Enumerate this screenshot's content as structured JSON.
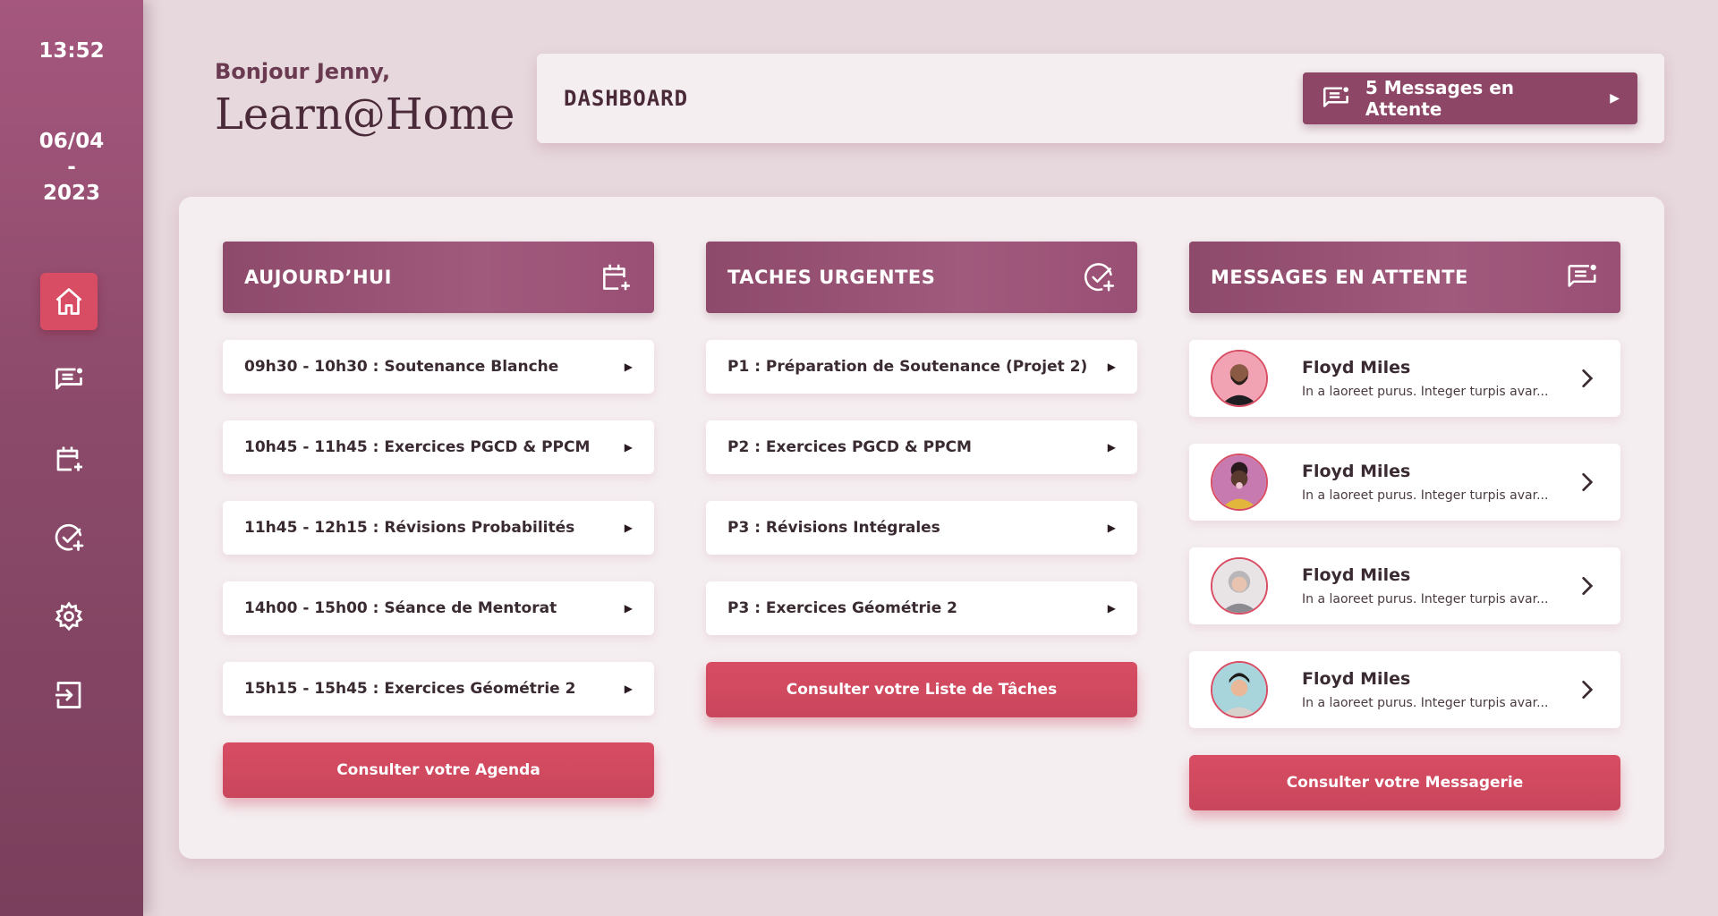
{
  "sidebar": {
    "time": "13:52",
    "date_line1": "06/04",
    "date_line2": "-",
    "date_line3": "2023",
    "nav": [
      "home-icon",
      "messages-icon",
      "calendar-add-icon",
      "task-check-icon",
      "settings-icon",
      "logout-icon"
    ],
    "active_index": 0
  },
  "header": {
    "greeting": "Bonjour Jenny,",
    "brand": "Learn@Home",
    "title": "DASHBOARD",
    "messages_button": "5 Messages en Attente"
  },
  "columns": {
    "today": {
      "title": "AUJOURD’HUI",
      "items": [
        "09h30 - 10h30 : Soutenance Blanche",
        "10h45 - 11h45 : Exercices PGCD & PPCM",
        "11h45 - 12h15 : Révisions Probabilités",
        "14h00 - 15h00 : Séance de Mentorat",
        "15h15 - 15h45 : Exercices Géométrie 2"
      ],
      "cta": "Consulter votre Agenda"
    },
    "urgent": {
      "title": "TACHES URGENTES",
      "items": [
        "P1 : Préparation de Soutenance (Projet 2)",
        "P2 : Exercices PGCD & PPCM",
        "P3 : Révisions Intégrales",
        "P3 : Exercices Géométrie 2"
      ],
      "cta": "Consulter votre Liste de Tâches"
    },
    "messages": {
      "title": "MESSAGES EN ATTENTE",
      "items": [
        {
          "name": "Floyd Miles",
          "preview": "In a laoreet purus. Integer turpis avar..."
        },
        {
          "name": "Floyd Miles",
          "preview": "In a laoreet purus. Integer turpis avar..."
        },
        {
          "name": "Floyd Miles",
          "preview": "In a laoreet purus. Integer turpis avar..."
        },
        {
          "name": "Floyd Miles",
          "preview": "In a laoreet purus. Integer turpis avar..."
        }
      ],
      "cta": "Consulter votre Messagerie"
    }
  },
  "colors": {
    "sidebar": "#8c4a6a",
    "accent": "#d84d63",
    "column_header": "#9a4f74",
    "background": "#e6d8dd"
  }
}
